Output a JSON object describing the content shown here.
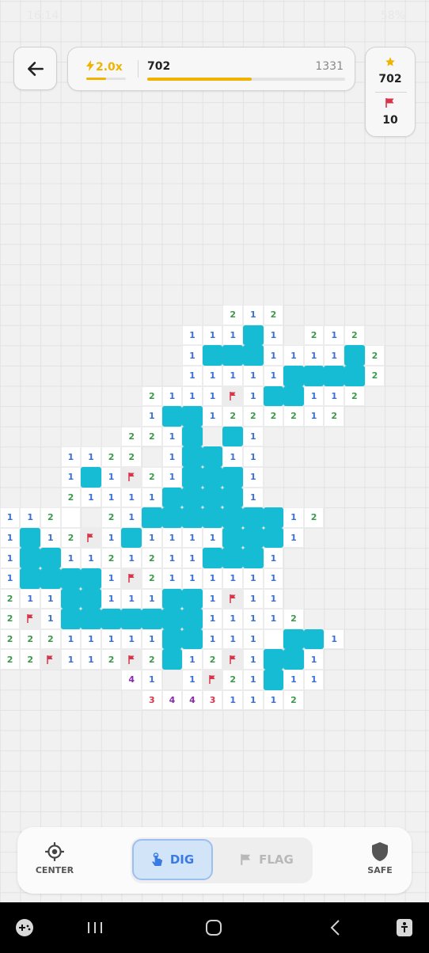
{
  "status_bar": {
    "time": "16:14",
    "battery": "58%"
  },
  "header": {
    "multiplier": "2.0x",
    "multiplier_progress": 0.5,
    "score": "702",
    "target": "1331",
    "score_progress": 0.527
  },
  "stats": {
    "stars": "702",
    "flags": "10"
  },
  "toolbar": {
    "center_label": "CENTER",
    "dig_label": "DIG",
    "flag_label": "FLAG",
    "safe_label": "SAFE",
    "active_mode": "DIG"
  },
  "colors": {
    "water": "#16bcd3",
    "accent": "#f0b400",
    "dig_active": "#3a7be3",
    "flag": "#d8344a"
  },
  "board": {
    "legend": "digit = adjacent count, W = water tile, F = flag, . = revealed blank, space = unrevealed",
    "first_column": 0,
    "first_row": 15,
    "rows": [
      "           212",
      "         111W1 212",
      "         1WWW1111W2",
      "         11111WWWW2",
      "       2111F1WW112",
      "       1WW1222212",
      "      221W W1",
      "   1122 1WW11",
      "   1W1F21WWW1",
      "   21111WWWW1",
      "1120 21WWWWWWW12",
      "1W12F1W1111WWW1",
      "1WW1121211WWW1",
      "1WWWW1F2111111",
      "211WW111WW1F11",
      "2F1WWWWWWW11112",
      "22211111WW1110WW1",
      "22F112F2W12F1WW1",
      "      41 1F21W11",
      "       34431112"
    ]
  }
}
